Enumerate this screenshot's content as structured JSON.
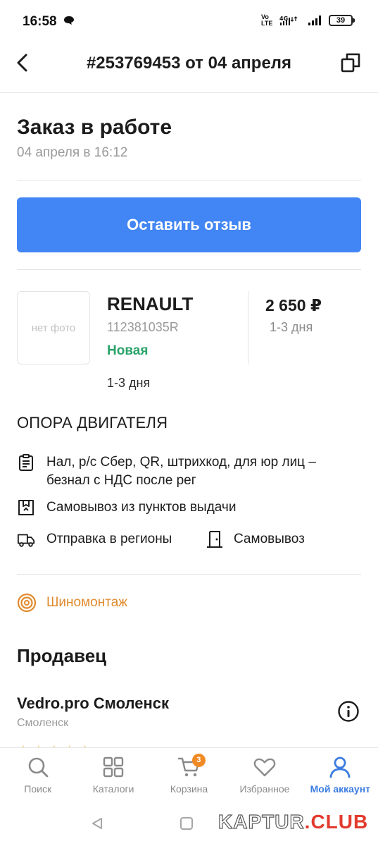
{
  "status_bar": {
    "time": "16:58",
    "network": "4G",
    "volte": "Vo LTE",
    "battery": "39"
  },
  "app_bar": {
    "title": "#253769453 от 04 апреля",
    "back_icon": "chevron-left-icon",
    "copy_icon": "copy-icon"
  },
  "order": {
    "status": "Заказ в работе",
    "date": "04 апреля в 16:12",
    "review_button": "Оставить отзыв"
  },
  "item": {
    "photo_placeholder": "нет фото",
    "brand": "RENAULT",
    "article": "112381035R",
    "condition": "Новая",
    "delivery_left": "1-3 дня",
    "price": "2 650 ₽",
    "delivery_right": "1-3 дня",
    "name": "ОПОРА ДВИГАТЕЛЯ"
  },
  "info": {
    "payment": "Нал, р/с Сбер, QR, штрихкод, для юр лиц – безнал с НДС после рег",
    "pickup_points": "Самовывоз из пунктов выдачи",
    "regions": "Отправка в регионы",
    "self_pickup": "Самовывоз",
    "tire_service": "Шиномонтаж"
  },
  "seller": {
    "heading": "Продавец",
    "name": "Vedro.pro Смоленск",
    "city": "Смоленск",
    "stars": "★★★★★"
  },
  "bottom_nav": {
    "items": [
      {
        "label": "Поиск",
        "icon": "search-icon"
      },
      {
        "label": "Каталоги",
        "icon": "grid-icon"
      },
      {
        "label": "Корзина",
        "icon": "cart-icon",
        "badge": "3"
      },
      {
        "label": "Избранное",
        "icon": "heart-icon"
      },
      {
        "label": "Мой аккаунт",
        "icon": "user-icon",
        "active": true
      }
    ]
  },
  "watermark": {
    "part1": "KAPTUR",
    "part2": ".",
    "part3": "CLUB"
  },
  "colors": {
    "primary": "#4285f4",
    "success": "#2aa36a",
    "accent": "#e08a2c",
    "active_nav": "#3b7de0",
    "badge": "#f08a24"
  }
}
